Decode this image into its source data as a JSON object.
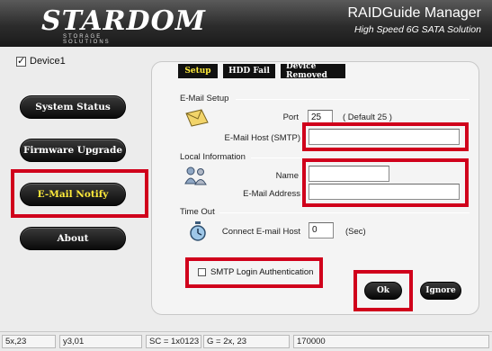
{
  "header": {
    "brand": "STARDOM",
    "brand_sub": "STORAGE SOLUTIONS",
    "app_title": "RAIDGuide Manager",
    "app_subtitle": "High Speed 6G SATA Solution"
  },
  "device": {
    "label": "Device1",
    "checked": true
  },
  "nav": {
    "items": [
      {
        "label": "System Status",
        "active": false
      },
      {
        "label": "Firmware Upgrade",
        "active": false
      },
      {
        "label": "E-Mail Notify",
        "active": true
      },
      {
        "label": "About",
        "active": false
      }
    ]
  },
  "tabs": [
    {
      "label": "Setup",
      "active": true
    },
    {
      "label": "HDD Fail",
      "active": false
    },
    {
      "label": "Device Removed",
      "active": false
    }
  ],
  "email_setup": {
    "section": "E-Mail Setup",
    "port_label": "Port",
    "port_value": "25",
    "port_default": "( Default 25 )",
    "host_label": "E-Mail Host (SMTP)",
    "host_value": ""
  },
  "local_info": {
    "section": "Local Information",
    "name_label": "Name",
    "name_value": "",
    "address_label": "E-Mail Address",
    "address_value": ""
  },
  "timeout": {
    "section": "Time Out",
    "connect_label": "Connect E-mail Host",
    "connect_value": "0",
    "unit": "(Sec)"
  },
  "auth": {
    "label": "SMTP Login Authentication",
    "checked": false
  },
  "actions": {
    "ok": "Ok",
    "ignore": "Ignore"
  },
  "statusbar": [
    "5x,23",
    "y3,01",
    "SC = 1x0123",
    "G = 2x, 23",
    "170000"
  ],
  "colors": {
    "highlight": "#d0001b",
    "active_text": "#ffeb3b"
  }
}
